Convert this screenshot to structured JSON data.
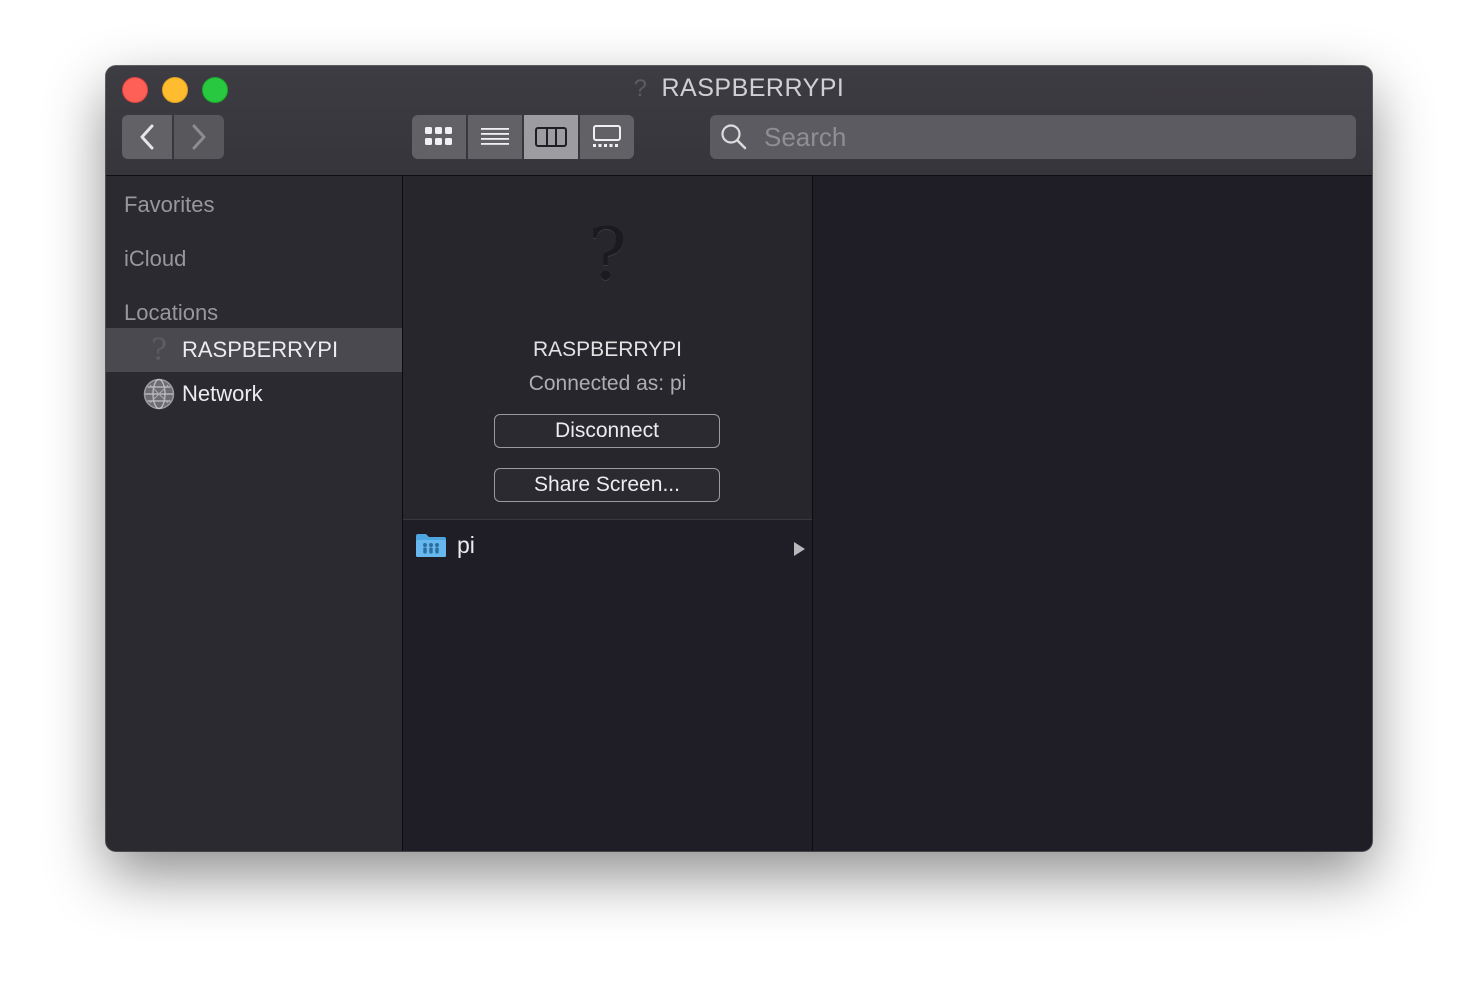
{
  "window": {
    "title": "RASPBERRYPI",
    "title_icon": "question-mark-icon"
  },
  "toolbar": {
    "back_icon": "chevron-left-icon",
    "forward_icon": "chevron-right-icon",
    "views": [
      {
        "name": "icon-view",
        "icon": "grid-icon",
        "active": false
      },
      {
        "name": "list-view",
        "icon": "list-icon",
        "active": false
      },
      {
        "name": "column-view",
        "icon": "columns-icon",
        "active": true
      },
      {
        "name": "gallery-view",
        "icon": "gallery-icon",
        "active": false
      }
    ],
    "search_placeholder": "Search"
  },
  "sidebar": {
    "headings": [
      "Favorites",
      "iCloud",
      "Locations"
    ],
    "items": [
      {
        "label": "RASPBERRYPI",
        "icon": "question-mark-icon",
        "selected": true
      },
      {
        "label": "Network",
        "icon": "network-globe-icon",
        "selected": false
      }
    ]
  },
  "preview": {
    "server_name": "RASPBERRYPI",
    "connected_as": "Connected as: pi",
    "disconnect_label": "Disconnect",
    "share_screen_label": "Share Screen..."
  },
  "files": [
    {
      "name": "pi",
      "icon": "shared-folder-icon",
      "has_children": true
    }
  ],
  "colors": {
    "close": "#fe5f57",
    "minimize": "#febc2e",
    "zoom": "#28c840",
    "folder": "#4ea6e0"
  }
}
